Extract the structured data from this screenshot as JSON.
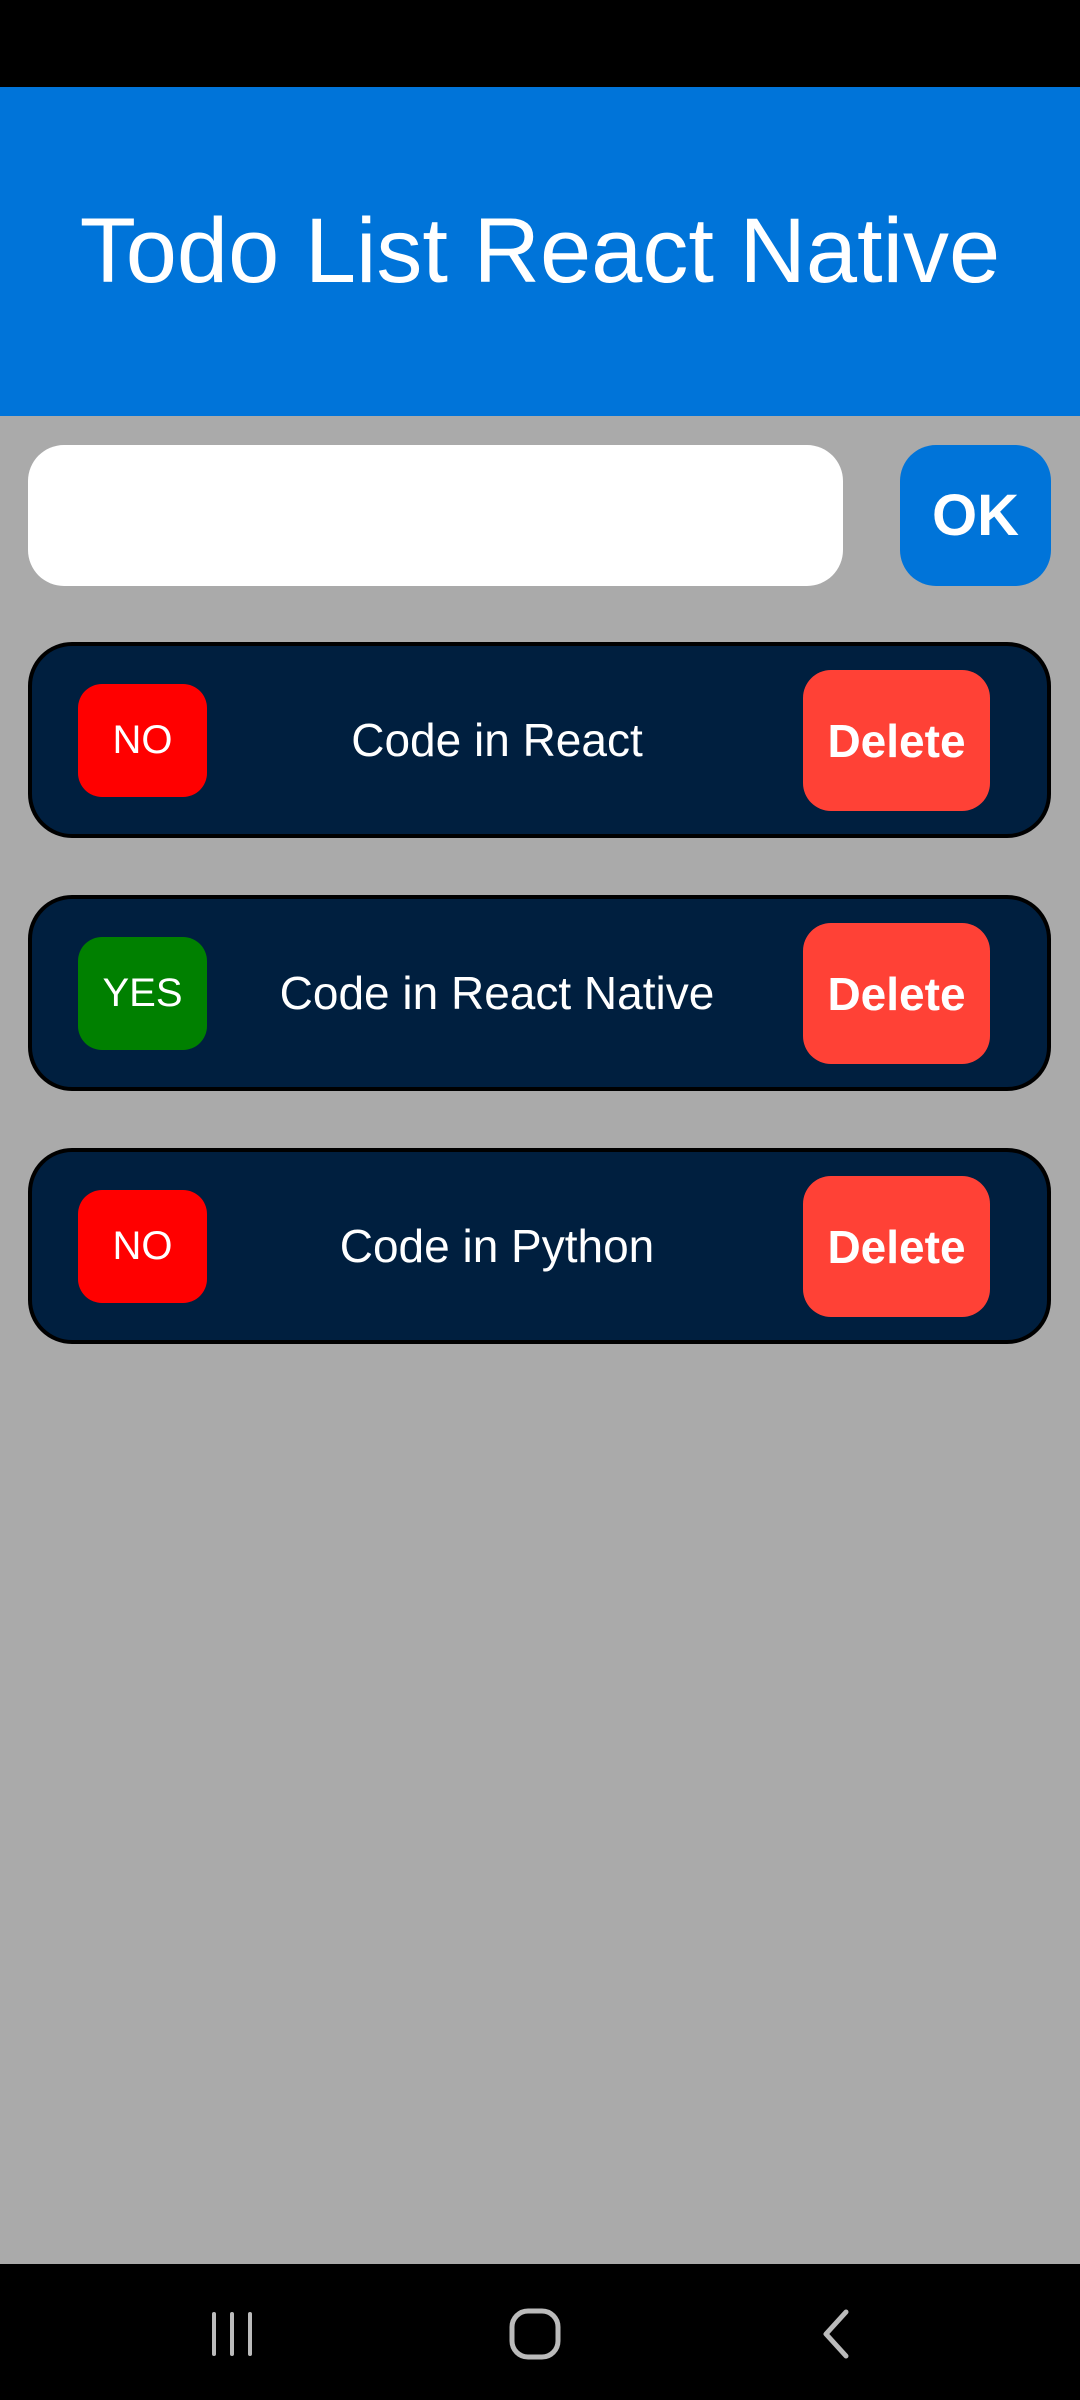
{
  "header": {
    "title": "Todo List React Native"
  },
  "input": {
    "value": "",
    "placeholder": ""
  },
  "ok_button": {
    "label": "OK"
  },
  "todos": [
    {
      "status": "NO",
      "done": false,
      "text": "Code in React",
      "delete_label": "Delete"
    },
    {
      "status": "YES",
      "done": true,
      "text": "Code in React Native",
      "delete_label": "Delete"
    },
    {
      "status": "NO",
      "done": false,
      "text": "Code in Python",
      "delete_label": "Delete"
    }
  ],
  "colors": {
    "header": "#0074d9",
    "card": "#001f3f",
    "no": "#ff0000",
    "yes": "#008000",
    "delete": "#ff4136",
    "background": "#aaaaaa"
  },
  "navbar": {
    "icons": [
      "recent-apps-icon",
      "home-icon",
      "back-icon"
    ]
  }
}
